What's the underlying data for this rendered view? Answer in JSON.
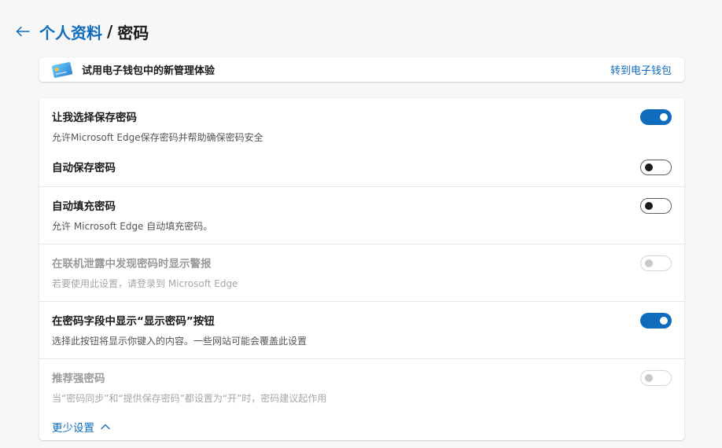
{
  "header": {
    "back_icon": "arrow-left-icon",
    "crumb_parent": "个人资料",
    "crumb_separator": "/",
    "crumb_current": "密码"
  },
  "banner": {
    "icon": "wallet-card-icon",
    "text": "试用电子钱包中的新管理体验",
    "link": "转到电子钱包"
  },
  "settings": [
    {
      "title": "让我选择保存密码",
      "desc": "允许Microsoft Edge保存密码并帮助确保密码安全",
      "state": "on"
    },
    {
      "title": "自动保存密码",
      "desc": "",
      "state": "off"
    },
    {
      "title": "自动填充密码",
      "desc": "允许 Microsoft Edge 自动填充密码。",
      "state": "off"
    },
    {
      "title": "在联机泄露中发现密码时显示警报",
      "desc": "若要使用此设置，请登录到 Microsoft Edge",
      "state": "disabled"
    },
    {
      "title": "在密码字段中显示“显示密码”按钮",
      "desc": "选择此按钮将显示你键入的内容。一些网站可能会覆盖此设置",
      "state": "on"
    },
    {
      "title": "推荐强密码",
      "desc": "当“密码同步”和“提供保存密码”都设置为“开”时，密码建议起作用",
      "state": "disabled"
    }
  ],
  "footer": {
    "less_settings": "更少设置",
    "chevron_icon": "chevron-up-icon"
  },
  "colors": {
    "accent": "#0f6cbd",
    "background": "#f7f7f7",
    "card": "#ffffff"
  }
}
